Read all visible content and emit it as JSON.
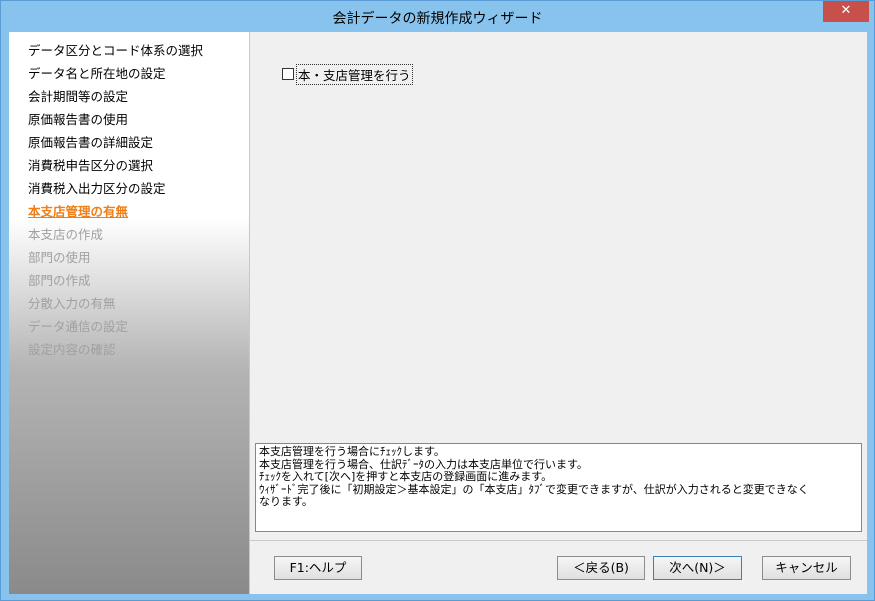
{
  "window": {
    "title": "会計データの新規作成ウィザード",
    "close_glyph": "✕"
  },
  "nav": {
    "items": [
      {
        "label": "データ区分とコード体系の選択",
        "state": "done"
      },
      {
        "label": "データ名と所在地の設定",
        "state": "done"
      },
      {
        "label": "会計期間等の設定",
        "state": "done"
      },
      {
        "label": "原価報告書の使用",
        "state": "done"
      },
      {
        "label": "原価報告書の詳細設定",
        "state": "done"
      },
      {
        "label": "消費税申告区分の選択",
        "state": "done"
      },
      {
        "label": "消費税入出力区分の設定",
        "state": "done"
      },
      {
        "label": "本支店管理の有無",
        "state": "current"
      },
      {
        "label": "本支店の作成",
        "state": "pending"
      },
      {
        "label": "部門の使用",
        "state": "pending"
      },
      {
        "label": "部門の作成",
        "state": "pending"
      },
      {
        "label": "分散入力の有無",
        "state": "pending"
      },
      {
        "label": "データ通信の設定",
        "state": "pending"
      },
      {
        "label": "設定内容の確認",
        "state": "pending"
      }
    ]
  },
  "main": {
    "checkbox_label": "本・支店管理を行う",
    "checkbox_checked": false
  },
  "help": {
    "lines": [
      "本支店管理を行う場合にﾁｪｯｸします。",
      "本支店管理を行う場合、仕訳ﾃﾞｰﾀの入力は本支店単位で行います。",
      "ﾁｪｯｸを入れて[次へ]を押すと本支店の登録画面に進みます。",
      "ｳｨｻﾞｰﾄﾞ完了後に「初期設定＞基本設定」の「本支店」ﾀﾌﾞで変更できますが、仕訳が入力されると変更できなく",
      "なります。"
    ]
  },
  "buttons": {
    "help": "F1:ヘルプ",
    "back": "＜戻る(B)",
    "next": "次へ(N)＞",
    "cancel": "キャンセル"
  },
  "colors": {
    "current_step": "#f07f17",
    "pending_step": "#a0a0a0",
    "titlebar": "#87c3ec",
    "close_button": "#c7504a"
  }
}
